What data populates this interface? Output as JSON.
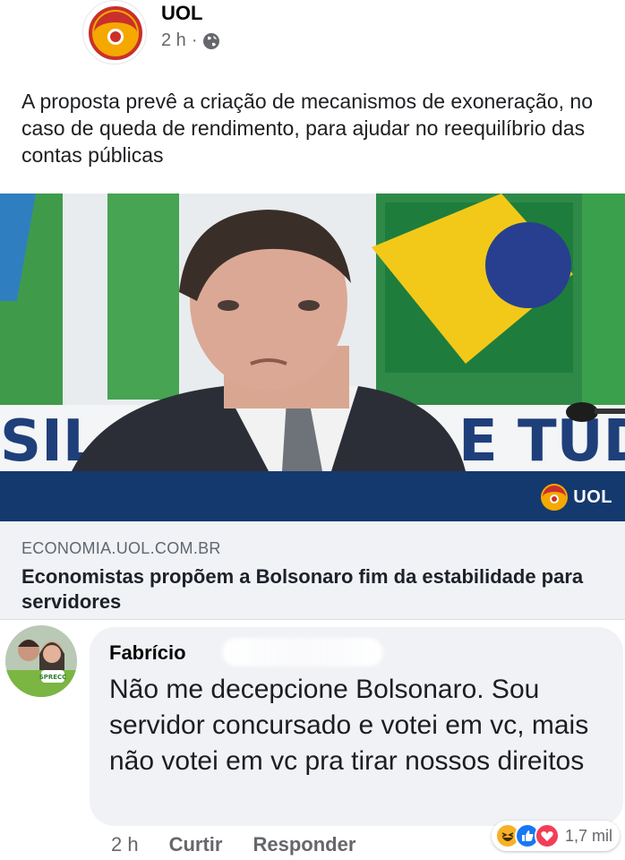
{
  "post": {
    "page_name": "UOL",
    "time": "2 h",
    "separator": "·",
    "privacy_icon": "globe-icon",
    "text": "A proposta prevê a criação de mecanismos de exoneração, no caso de queda de rendimento, para ajudar no reequilíbrio das contas públicas"
  },
  "link": {
    "image_caption_logo": "UOL",
    "background_letters_left": "SIL A",
    "background_letters_right": "E TUD",
    "domain": "ECONOMIA.UOL.COM.BR",
    "title": "Economistas propõem a Bolsonaro fim da estabilidade para servidores"
  },
  "comment": {
    "author": "Fabrício",
    "avatar_badge": "SPRECC",
    "text": "Não me decepcione Bolsonaro. Sou servidor concursado e votei em vc, mais não votei em vc pra tirar nossos direitos",
    "time": "2 h",
    "like_label": "Curtir",
    "reply_label": "Responder",
    "reactions": [
      "haha-reaction-icon",
      "like-reaction-icon",
      "love-reaction-icon"
    ],
    "reaction_count": "1,7 mil"
  },
  "colors": {
    "uol_orange": "#f5a800",
    "band_blue": "#14396e",
    "like_blue": "#1877f2",
    "love_red": "#f33e58"
  }
}
